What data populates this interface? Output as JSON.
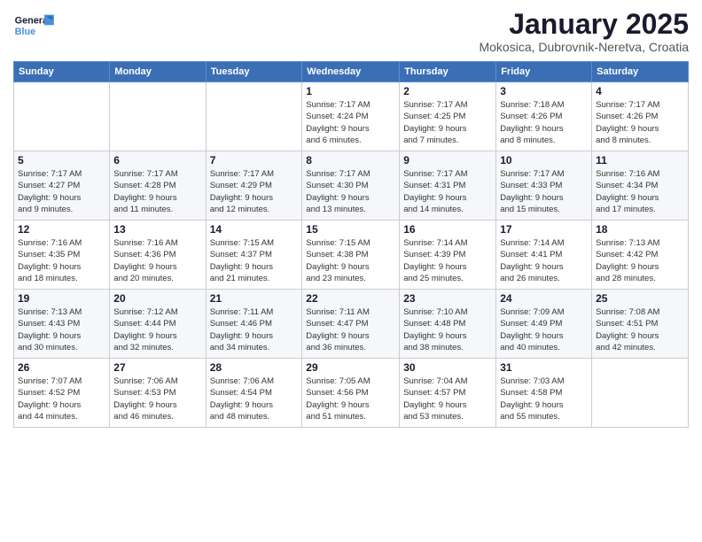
{
  "header": {
    "logo_general": "General",
    "logo_blue": "Blue",
    "month_title": "January 2025",
    "location": "Mokosica, Dubrovnik-Neretva, Croatia"
  },
  "days_of_week": [
    "Sunday",
    "Monday",
    "Tuesday",
    "Wednesday",
    "Thursday",
    "Friday",
    "Saturday"
  ],
  "weeks": [
    [
      {
        "day": "",
        "info": ""
      },
      {
        "day": "",
        "info": ""
      },
      {
        "day": "",
        "info": ""
      },
      {
        "day": "1",
        "info": "Sunrise: 7:17 AM\nSunset: 4:24 PM\nDaylight: 9 hours\nand 6 minutes."
      },
      {
        "day": "2",
        "info": "Sunrise: 7:17 AM\nSunset: 4:25 PM\nDaylight: 9 hours\nand 7 minutes."
      },
      {
        "day": "3",
        "info": "Sunrise: 7:18 AM\nSunset: 4:26 PM\nDaylight: 9 hours\nand 8 minutes."
      },
      {
        "day": "4",
        "info": "Sunrise: 7:17 AM\nSunset: 4:26 PM\nDaylight: 9 hours\nand 8 minutes."
      }
    ],
    [
      {
        "day": "5",
        "info": "Sunrise: 7:17 AM\nSunset: 4:27 PM\nDaylight: 9 hours\nand 9 minutes."
      },
      {
        "day": "6",
        "info": "Sunrise: 7:17 AM\nSunset: 4:28 PM\nDaylight: 9 hours\nand 11 minutes."
      },
      {
        "day": "7",
        "info": "Sunrise: 7:17 AM\nSunset: 4:29 PM\nDaylight: 9 hours\nand 12 minutes."
      },
      {
        "day": "8",
        "info": "Sunrise: 7:17 AM\nSunset: 4:30 PM\nDaylight: 9 hours\nand 13 minutes."
      },
      {
        "day": "9",
        "info": "Sunrise: 7:17 AM\nSunset: 4:31 PM\nDaylight: 9 hours\nand 14 minutes."
      },
      {
        "day": "10",
        "info": "Sunrise: 7:17 AM\nSunset: 4:33 PM\nDaylight: 9 hours\nand 15 minutes."
      },
      {
        "day": "11",
        "info": "Sunrise: 7:16 AM\nSunset: 4:34 PM\nDaylight: 9 hours\nand 17 minutes."
      }
    ],
    [
      {
        "day": "12",
        "info": "Sunrise: 7:16 AM\nSunset: 4:35 PM\nDaylight: 9 hours\nand 18 minutes."
      },
      {
        "day": "13",
        "info": "Sunrise: 7:16 AM\nSunset: 4:36 PM\nDaylight: 9 hours\nand 20 minutes."
      },
      {
        "day": "14",
        "info": "Sunrise: 7:15 AM\nSunset: 4:37 PM\nDaylight: 9 hours\nand 21 minutes."
      },
      {
        "day": "15",
        "info": "Sunrise: 7:15 AM\nSunset: 4:38 PM\nDaylight: 9 hours\nand 23 minutes."
      },
      {
        "day": "16",
        "info": "Sunrise: 7:14 AM\nSunset: 4:39 PM\nDaylight: 9 hours\nand 25 minutes."
      },
      {
        "day": "17",
        "info": "Sunrise: 7:14 AM\nSunset: 4:41 PM\nDaylight: 9 hours\nand 26 minutes."
      },
      {
        "day": "18",
        "info": "Sunrise: 7:13 AM\nSunset: 4:42 PM\nDaylight: 9 hours\nand 28 minutes."
      }
    ],
    [
      {
        "day": "19",
        "info": "Sunrise: 7:13 AM\nSunset: 4:43 PM\nDaylight: 9 hours\nand 30 minutes."
      },
      {
        "day": "20",
        "info": "Sunrise: 7:12 AM\nSunset: 4:44 PM\nDaylight: 9 hours\nand 32 minutes."
      },
      {
        "day": "21",
        "info": "Sunrise: 7:11 AM\nSunset: 4:46 PM\nDaylight: 9 hours\nand 34 minutes."
      },
      {
        "day": "22",
        "info": "Sunrise: 7:11 AM\nSunset: 4:47 PM\nDaylight: 9 hours\nand 36 minutes."
      },
      {
        "day": "23",
        "info": "Sunrise: 7:10 AM\nSunset: 4:48 PM\nDaylight: 9 hours\nand 38 minutes."
      },
      {
        "day": "24",
        "info": "Sunrise: 7:09 AM\nSunset: 4:49 PM\nDaylight: 9 hours\nand 40 minutes."
      },
      {
        "day": "25",
        "info": "Sunrise: 7:08 AM\nSunset: 4:51 PM\nDaylight: 9 hours\nand 42 minutes."
      }
    ],
    [
      {
        "day": "26",
        "info": "Sunrise: 7:07 AM\nSunset: 4:52 PM\nDaylight: 9 hours\nand 44 minutes."
      },
      {
        "day": "27",
        "info": "Sunrise: 7:06 AM\nSunset: 4:53 PM\nDaylight: 9 hours\nand 46 minutes."
      },
      {
        "day": "28",
        "info": "Sunrise: 7:06 AM\nSunset: 4:54 PM\nDaylight: 9 hours\nand 48 minutes."
      },
      {
        "day": "29",
        "info": "Sunrise: 7:05 AM\nSunset: 4:56 PM\nDaylight: 9 hours\nand 51 minutes."
      },
      {
        "day": "30",
        "info": "Sunrise: 7:04 AM\nSunset: 4:57 PM\nDaylight: 9 hours\nand 53 minutes."
      },
      {
        "day": "31",
        "info": "Sunrise: 7:03 AM\nSunset: 4:58 PM\nDaylight: 9 hours\nand 55 minutes."
      },
      {
        "day": "",
        "info": ""
      }
    ]
  ]
}
